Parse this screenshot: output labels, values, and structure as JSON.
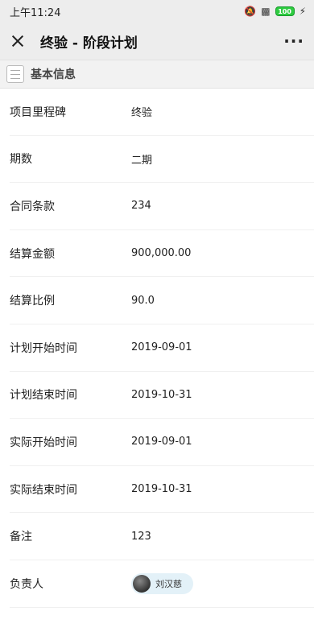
{
  "status_bar": {
    "time": "上午11:24",
    "battery": "100"
  },
  "header": {
    "title": "终验 - 阶段计划",
    "more": "···"
  },
  "section": {
    "title": "基本信息"
  },
  "fields": [
    {
      "label": "项目里程碑",
      "value": "终验"
    },
    {
      "label": "期数",
      "value": "二期"
    },
    {
      "label": "合同条款",
      "value": "234"
    },
    {
      "label": "结算金额",
      "value": "900,000.00"
    },
    {
      "label": "结算比例",
      "value": "90.0"
    },
    {
      "label": "计划开始时间",
      "value": "2019-09-01"
    },
    {
      "label": "计划结束时间",
      "value": "2019-10-31"
    },
    {
      "label": "实际开始时间",
      "value": "2019-09-01"
    },
    {
      "label": "实际结束时间",
      "value": "2019-10-31"
    },
    {
      "label": "备注",
      "value": "123"
    }
  ],
  "owner": {
    "label": "负责人",
    "name": "刘汉慈"
  }
}
